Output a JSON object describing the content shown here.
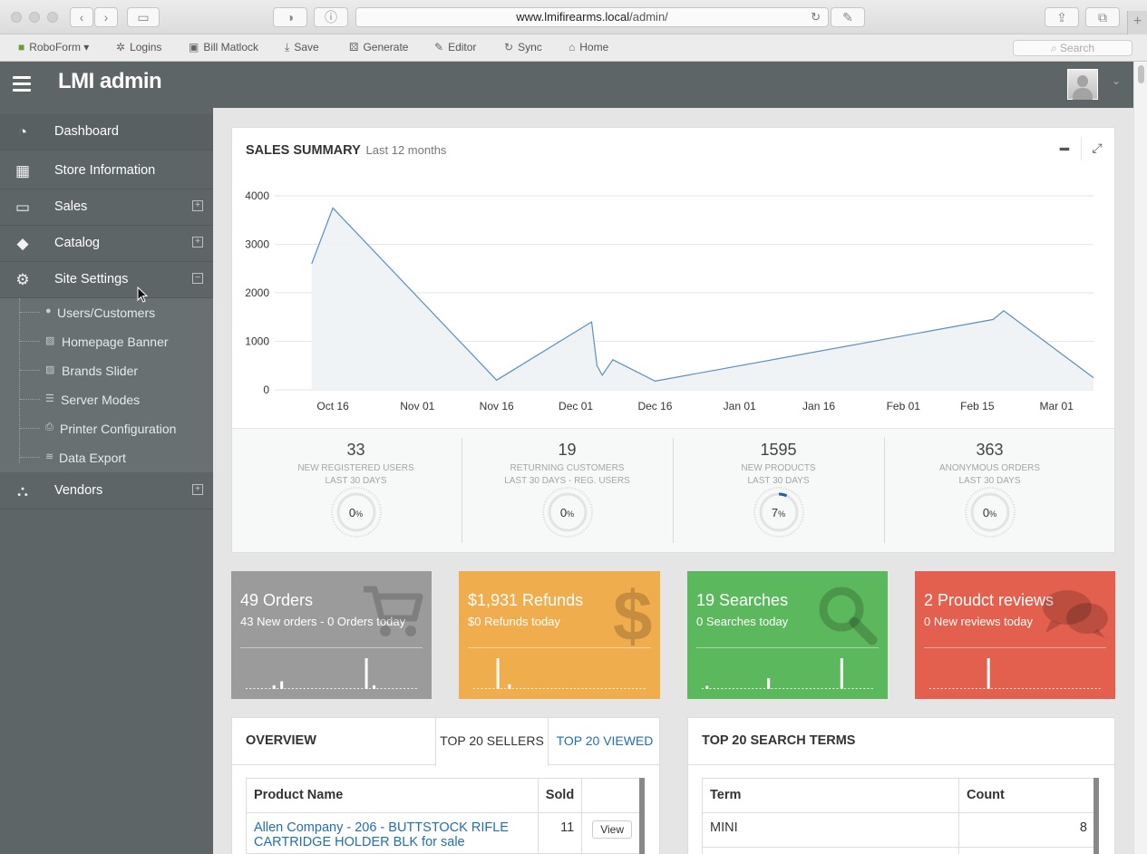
{
  "browser": {
    "url_host": "www.lmifirearms.local",
    "url_path": "/admin/",
    "toolbar": [
      {
        "label": "RoboForm",
        "icon": "roboform-icon"
      },
      {
        "label": "Logins",
        "icon": "logins-icon"
      },
      {
        "label": "Bill Matlock",
        "icon": "identity-icon"
      },
      {
        "label": "Save",
        "icon": "save-icon"
      },
      {
        "label": "Generate",
        "icon": "generate-icon"
      },
      {
        "label": "Editor",
        "icon": "editor-icon"
      },
      {
        "label": "Sync",
        "icon": "sync-icon"
      },
      {
        "label": "Home",
        "icon": "home-icon"
      }
    ],
    "search_placeholder": "Search"
  },
  "header": {
    "brand": "LMI admin"
  },
  "sidebar": {
    "items": [
      {
        "label": "Dashboard",
        "icon": "dashboard-icon"
      },
      {
        "label": "Store Information",
        "icon": "building-icon"
      },
      {
        "label": "Sales",
        "icon": "money-icon",
        "expand": "+"
      },
      {
        "label": "Catalog",
        "icon": "tags-icon",
        "expand": "+"
      },
      {
        "label": "Site Settings",
        "icon": "gears-icon",
        "expand": "−"
      },
      {
        "label": "Vendors",
        "icon": "sitemap-icon",
        "expand": "+"
      }
    ],
    "submenu": [
      {
        "label": "Users/Customers",
        "icon": "user-icon"
      },
      {
        "label": "Homepage Banner",
        "icon": "picture-icon"
      },
      {
        "label": "Brands Slider",
        "icon": "picture-icon"
      },
      {
        "label": "Server Modes",
        "icon": "list-icon"
      },
      {
        "label": "Printer Configuration",
        "icon": "print-icon"
      },
      {
        "label": "Data Export",
        "icon": "database-icon"
      }
    ]
  },
  "sales_summary": {
    "title": "SALES SUMMARY",
    "subtitle": "Last 12 months",
    "stats": [
      {
        "value": "33",
        "label1": "NEW REGISTERED USERS",
        "label2": "LAST 30 DAYS",
        "percent": 0,
        "pct_label": "0"
      },
      {
        "value": "19",
        "label1": "RETURNING CUSTOMERS",
        "label2": "LAST 30 DAYS - REG. USERS",
        "percent": 0,
        "pct_label": "0"
      },
      {
        "value": "1595",
        "label1": "NEW PRODUCTS",
        "label2": "LAST 30 DAYS",
        "percent": 7,
        "pct_label": "7"
      },
      {
        "value": "363",
        "label1": "ANONYMOUS ORDERS",
        "label2": "LAST 30 DAYS",
        "percent": 0,
        "pct_label": "0"
      }
    ],
    "pct_unit": "%"
  },
  "chart_data": {
    "type": "area",
    "title": "SALES SUMMARY",
    "subtitle": "Last 12 months",
    "ylim": [
      0,
      4000
    ],
    "yticks": [
      "4000",
      "3000",
      "2000",
      "1000",
      "0"
    ],
    "xticks": [
      "Oct 16",
      "Nov 01",
      "Nov 16",
      "Dec 01",
      "Dec 16",
      "Jan 01",
      "Jan 16",
      "Feb 01",
      "Feb 15",
      "Mar 01"
    ],
    "grid": true,
    "series": [
      {
        "x": [
          "2015-10-12",
          "2015-10-16",
          "2015-11-16",
          "2015-12-04",
          "2015-12-05",
          "2015-12-06",
          "2015-12-08",
          "2015-12-16",
          "2016-02-18",
          "2016-02-20",
          "2016-03-08"
        ],
        "values": [
          2600,
          3750,
          200,
          1400,
          500,
          300,
          620,
          180,
          1450,
          1630,
          250
        ]
      }
    ]
  },
  "tiles": [
    {
      "title": "49 Orders",
      "sub": "43 New orders - 0 Orders today",
      "color": "#9b9b9b",
      "icon": "cart-icon",
      "bars": [
        0,
        0,
        0,
        0,
        0,
        0,
        0,
        0.12,
        0,
        0.25,
        0,
        0,
        0,
        0,
        0,
        0,
        0,
        0,
        0,
        0,
        0,
        0,
        0,
        0,
        0,
        0,
        0,
        0,
        0,
        0,
        0,
        1,
        0,
        0.12,
        0,
        0,
        0,
        0,
        0,
        0,
        0,
        0,
        0,
        0,
        0
      ]
    },
    {
      "title": "$1,931 Refunds",
      "sub": "$0 Refunds today",
      "color": "#f0ad4e",
      "icon": "dollar-icon",
      "bars": [
        0,
        0,
        0,
        0,
        0,
        0,
        1,
        0,
        0,
        0.15,
        0,
        0,
        0,
        0,
        0,
        0,
        0,
        0,
        0,
        0,
        0,
        0,
        0,
        0,
        0,
        0,
        0,
        0,
        0,
        0,
        0,
        0,
        0,
        0,
        0,
        0,
        0,
        0,
        0,
        0,
        0,
        0,
        0,
        0,
        0
      ]
    },
    {
      "title": "19 Searches",
      "sub": "0 Searches today",
      "color": "#5cb85c",
      "icon": "search-icon",
      "bars": [
        0,
        0.1,
        0,
        0,
        0,
        0,
        0,
        0,
        0,
        0,
        0,
        0,
        0,
        0,
        0,
        0,
        0,
        0.35,
        0,
        0,
        0,
        0,
        0,
        0,
        0,
        0,
        0,
        0,
        0,
        0,
        0,
        0,
        0,
        0,
        0,
        0,
        1,
        0,
        0,
        0,
        0,
        0,
        0,
        0,
        0
      ]
    },
    {
      "title": "2 Proudct reviews",
      "sub": "0 New reviews today",
      "color": "#e4604e",
      "icon": "comments-icon",
      "bars": [
        0,
        0,
        0,
        0,
        0,
        0,
        0,
        0,
        0,
        0,
        0,
        0,
        0,
        0,
        0,
        1,
        0,
        0,
        0,
        0,
        0,
        0,
        0,
        0,
        0,
        0,
        0,
        0,
        0,
        0,
        0,
        0,
        0,
        0,
        0,
        0,
        0,
        0,
        0,
        0,
        0,
        0,
        0,
        0,
        0
      ]
    }
  ],
  "overview": {
    "title": "OVERVIEW",
    "tabs": [
      "TOP 20 SELLERS",
      "TOP 20 VIEWED"
    ],
    "columns": [
      "Product Name",
      "Sold",
      ""
    ],
    "rows": [
      {
        "name_line1": "Allen Company - 206 - BUTTSTOCK RIFLE",
        "name_line2": "CARTRIDGE HOLDER BLK for sale",
        "sold": "11",
        "action": "View"
      }
    ]
  },
  "search_terms": {
    "title": "TOP 20 SEARCH TERMS",
    "columns": [
      "Term",
      "Count"
    ],
    "rows": [
      {
        "term": "MINI",
        "count": "8"
      }
    ]
  }
}
